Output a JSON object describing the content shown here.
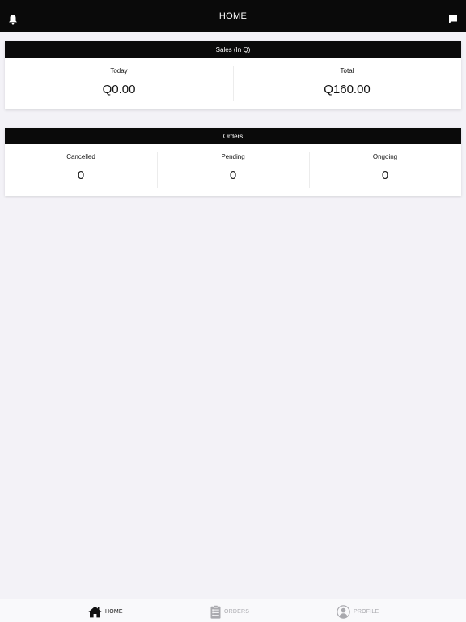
{
  "header": {
    "title": "HOME",
    "left_icon": "bell-icon",
    "right_icon": "chat-icon"
  },
  "sales": {
    "title": "Sales (In Q)",
    "stats": [
      {
        "label": "Today",
        "value": "Q0.00"
      },
      {
        "label": "Total",
        "value": "Q160.00"
      }
    ]
  },
  "orders": {
    "title": "Orders",
    "stats": [
      {
        "label": "Cancelled",
        "value": "0"
      },
      {
        "label": "Pending",
        "value": "0"
      },
      {
        "label": "Ongoing",
        "value": "0"
      }
    ]
  },
  "tabbar": {
    "items": [
      {
        "label": "HOME",
        "icon": "home-icon",
        "active": true
      },
      {
        "label": "ORDERS",
        "icon": "clipboard-icon",
        "active": false
      },
      {
        "label": "PROFILE",
        "icon": "user-circle-icon",
        "active": false
      }
    ]
  },
  "colors": {
    "background": "#f3f2f7",
    "bar": "#0a0a0a",
    "inactive_tab": "#a9a9ae"
  }
}
